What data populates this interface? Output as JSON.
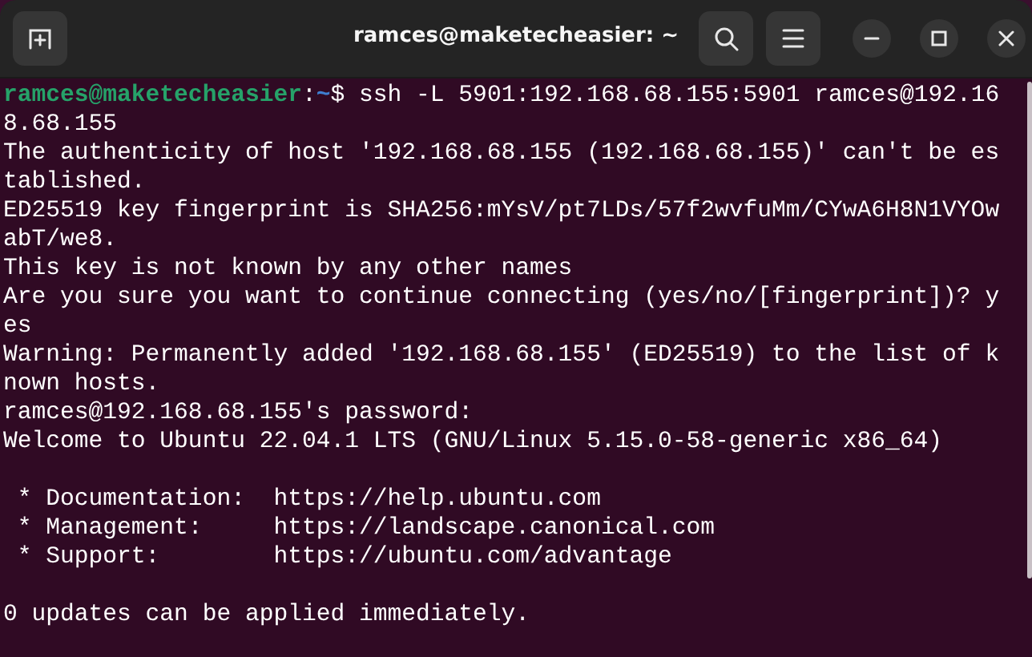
{
  "window": {
    "title": "ramces@maketecheasier: ~"
  },
  "terminal": {
    "lines": [
      {
        "kind": "prompt",
        "segments": [
          {
            "kind": "user",
            "text": "ramces@maketecheasier"
          },
          {
            "kind": "plain",
            "text": ":"
          },
          {
            "kind": "path",
            "text": "~"
          },
          {
            "kind": "plain",
            "text": "$ ssh -L 5901:192.168.68.155:5901 ramces@192.16"
          }
        ]
      },
      {
        "kind": "output",
        "text": "8.68.155"
      },
      {
        "kind": "output",
        "text": "The authenticity of host '192.168.68.155 (192.168.68.155)' can't be es"
      },
      {
        "kind": "output",
        "text": "tablished."
      },
      {
        "kind": "output",
        "text": "ED25519 key fingerprint is SHA256:mYsV/pt7LDs/57f2wvfuMm/CYwA6H8N1VYOw"
      },
      {
        "kind": "output",
        "text": "abT/we8."
      },
      {
        "kind": "output",
        "text": "This key is not known by any other names"
      },
      {
        "kind": "output",
        "text": "Are you sure you want to continue connecting (yes/no/[fingerprint])? y"
      },
      {
        "kind": "output",
        "text": "es"
      },
      {
        "kind": "output",
        "text": "Warning: Permanently added '192.168.68.155' (ED25519) to the list of k"
      },
      {
        "kind": "output",
        "text": "nown hosts."
      },
      {
        "kind": "output",
        "text": "ramces@192.168.68.155's password:"
      },
      {
        "kind": "output",
        "text": "Welcome to Ubuntu 22.04.1 LTS (GNU/Linux 5.15.0-58-generic x86_64)"
      },
      {
        "kind": "blank"
      },
      {
        "kind": "output",
        "text": " * Documentation:  https://help.ubuntu.com"
      },
      {
        "kind": "output",
        "text": " * Management:     https://landscape.canonical.com"
      },
      {
        "kind": "output",
        "text": " * Support:        https://ubuntu.com/advantage"
      },
      {
        "kind": "blank"
      },
      {
        "kind": "output",
        "text": "0 updates can be applied immediately."
      }
    ]
  }
}
